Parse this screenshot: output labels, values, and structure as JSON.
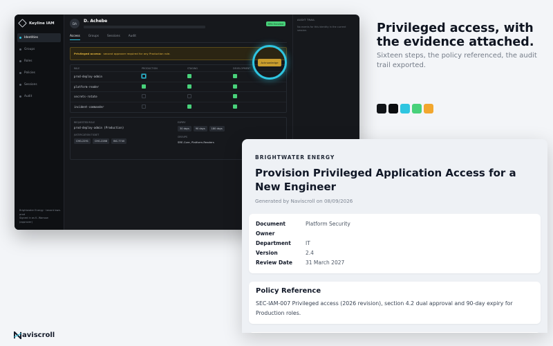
{
  "app": {
    "brand": "Keyline IAM",
    "nav": [
      {
        "label": "Identities",
        "active": true
      },
      {
        "label": "Groups",
        "active": false
      },
      {
        "label": "Roles",
        "active": false
      },
      {
        "label": "Policies",
        "active": false
      },
      {
        "label": "Sessions",
        "active": false
      },
      {
        "label": "Audit",
        "active": false
      }
    ],
    "sidebar_footer": [
      "Brightwater Energy · tenant bwe-prod",
      "Signed in as K. Warsow (approver)"
    ],
    "user": {
      "initials": "DA",
      "name": "D. Achebe",
      "badge": "MFA Enrolled"
    },
    "tabs": [
      "Access",
      "Groups",
      "Sessions",
      "Audit"
    ],
    "active_tab": "Access",
    "warning": {
      "bold": "Privileged access:",
      "text": "second approver required for any Production role.",
      "action": "Acknowledge"
    },
    "table": {
      "headers": [
        "ROLE",
        "PRODUCTION",
        "STAGING",
        "DEVELOPMENT"
      ],
      "rows": [
        {
          "role": "prod-deploy-admin",
          "prod": "focus",
          "staging": "on",
          "dev": "on"
        },
        {
          "role": "platform-reader",
          "prod": "on",
          "staging": "on",
          "dev": "on"
        },
        {
          "role": "secrets-rotate",
          "prod": "off",
          "staging": "off",
          "dev": "on"
        },
        {
          "role": "incident-commander",
          "prod": "off",
          "staging": "on",
          "dev": "on"
        }
      ]
    },
    "request": {
      "requested_role_label": "REQUESTED ROLE",
      "requested_role": "prod-deploy-admin (Production)",
      "ticket_label": "JUSTIFICATION TICKET",
      "tickets": [
        "CHG-2291",
        "CHG-2288",
        "INC-7740"
      ],
      "expiry_label": "EXPIRY",
      "expiry_options": [
        "30 days",
        "90 days",
        "180 days"
      ],
      "groups_label": "GROUPS",
      "groups": "SRE-Core, Platform-Readers"
    },
    "audit": {
      "title": "AUDIT TRAIL",
      "empty": "No events for this identity in the current session."
    }
  },
  "hero": {
    "headline": "Privileged access, with the evidence attached.",
    "subline": "Sixteen steps, the policy referenced, the audit trail exported.",
    "swatches": [
      "#111418",
      "#0b0d10",
      "#2ec5e0",
      "#48d17a",
      "#f2a72e"
    ]
  },
  "doc": {
    "org": "BRIGHTWATER ENERGY",
    "title": "Provision Privileged Application Access for a New Engineer",
    "generated": "Generated by Naviscroll on 08/09/2026",
    "meta": [
      {
        "k": "Document Owner",
        "v": "Platform Security"
      },
      {
        "k": "Department",
        "v": "IT"
      },
      {
        "k": "Version",
        "v": "2.4"
      },
      {
        "k": "Review Date",
        "v": "31 March 2027"
      }
    ],
    "policy_heading": "Policy Reference",
    "policy_text": "SEC-IAM-007 Privileged access (2026 revision), section 4.2 dual approval and 90-day expiry for Production roles."
  },
  "footer": {
    "logo_text": "aviscroll"
  }
}
